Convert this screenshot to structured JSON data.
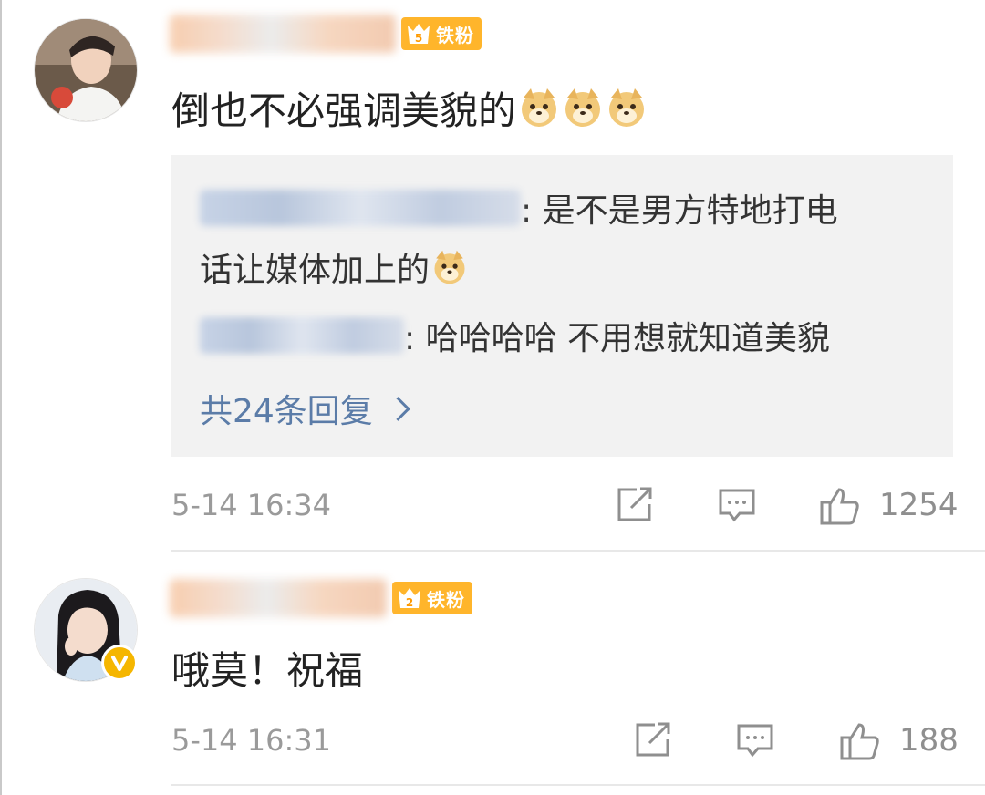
{
  "comments": [
    {
      "badge_label": "铁粉",
      "badge_level": "5",
      "text": "倒也不必强调美貌的",
      "emojis": [
        "doge",
        "doge",
        "doge"
      ],
      "replies": [
        {
          "text": ": 是不是男方特地打电",
          "text2": "话让媒体加上的"
        },
        {
          "text": ": 哈哈哈哈 不用想就知道美貌"
        }
      ],
      "more_replies": "共24条回复",
      "time": "5-14 16:34",
      "likes": "1254"
    },
    {
      "badge_label": "铁粉",
      "badge_level": "2",
      "text": "哦莫！祝福",
      "time": "5-14 16:31",
      "likes": "188"
    }
  ],
  "colors": {
    "badge": "#ffb52b",
    "link": "#5b7ca8",
    "meta": "#9a9a9a",
    "verified": "#f5b600"
  }
}
